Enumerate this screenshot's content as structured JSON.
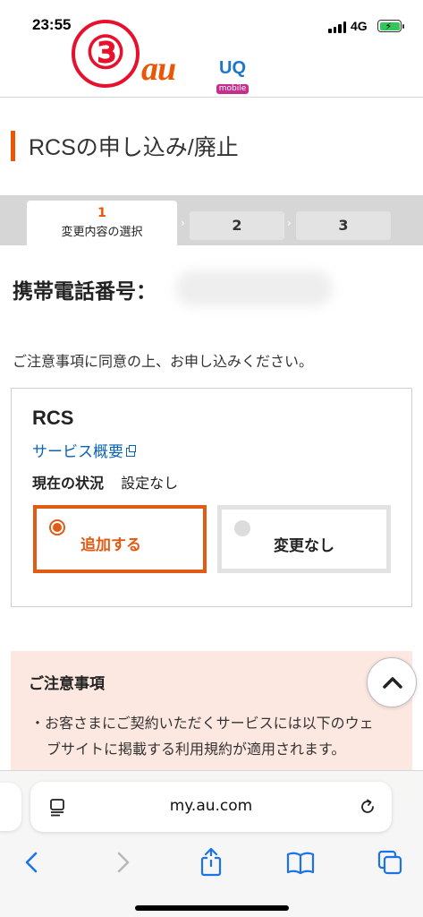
{
  "status_bar": {
    "time": "23:55",
    "network": "4G",
    "battery_color": "#32c759"
  },
  "header": {
    "step_badge": "③",
    "au_logo": "au",
    "uq_logo": "UQ",
    "uq_logo_sub": "mobile"
  },
  "page_title": "RCSの申し込み/廃止",
  "steps": [
    {
      "number": "1",
      "label": "変更内容の選択",
      "active": true
    },
    {
      "number": "2",
      "active": false
    },
    {
      "number": "3",
      "active": false
    }
  ],
  "phone_label": "携帯電話番号：",
  "notice_text": "ご注意事項に同意の上、お申し込みください。",
  "card": {
    "title": "RCS",
    "service_link": "サービス概要",
    "status_key": "現在の状況",
    "status_value": "設定なし",
    "options": [
      {
        "label": "追加する",
        "selected": true
      },
      {
        "label": "変更なし",
        "selected": false
      }
    ]
  },
  "caution": {
    "title": "ご注意事項",
    "bullet": "・お客さまにご契約いただくサービスには以下のウェブサイトに掲載する利用規約が適用されます。"
  },
  "browser": {
    "url": "my.au.com"
  },
  "colors": {
    "accent": "#eb5505",
    "link": "#0a64b4",
    "caution_bg": "#fde8e1"
  }
}
